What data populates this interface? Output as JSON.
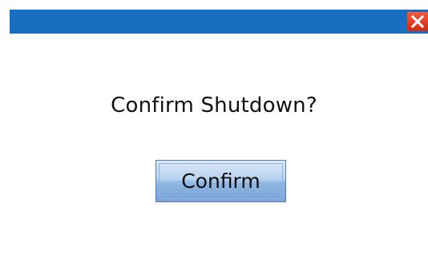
{
  "dialog": {
    "message": "Confirm Shutdown?",
    "confirm_label": "Confirm",
    "close_icon": "close-icon"
  },
  "colors": {
    "titlebar": "#1a6ec2",
    "close_button": "#e23d22",
    "button_border": "#4f7fb8",
    "background": "#ffffff"
  }
}
